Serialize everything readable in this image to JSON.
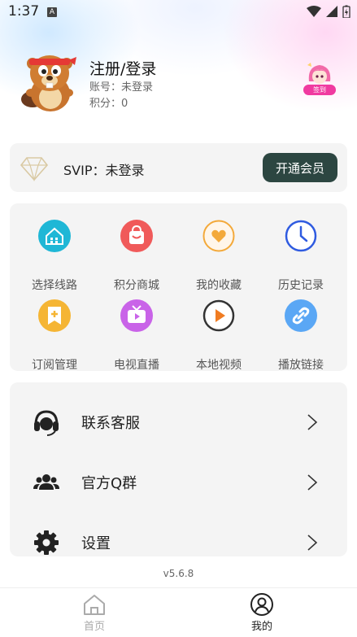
{
  "status_bar": {
    "time": "1:37",
    "notification_icon": "A"
  },
  "profile": {
    "name": "注册/登录",
    "account": "账号：未登录",
    "points": "积分：0",
    "avatar": "beaver-mascot-avatar",
    "sign_badge": "签到"
  },
  "svip": {
    "text": "SVIP：未登录",
    "button": "开通会员"
  },
  "grid": [
    {
      "label": "选择线路",
      "icon": "route-select-icon",
      "color": "#1fb7d6"
    },
    {
      "label": "积分商城",
      "icon": "shopping-bag-icon",
      "color": "#f05a5a"
    },
    {
      "label": "我的收藏",
      "icon": "heart-icon",
      "color": "#f3a93a"
    },
    {
      "label": "历史记录",
      "icon": "clock-icon",
      "color": "#2f5be0"
    },
    {
      "label": "订阅管理",
      "icon": "bookmark-plus-icon",
      "color": "#f5b534"
    },
    {
      "label": "电视直播",
      "icon": "tv-icon",
      "color": "#c963e8"
    },
    {
      "label": "本地视频",
      "icon": "play-circle-icon",
      "color": "#f07c22"
    },
    {
      "label": "播放链接",
      "icon": "link-icon",
      "color": "#5aa7f5"
    }
  ],
  "list": [
    {
      "label": "联系客服",
      "icon": "headset-icon"
    },
    {
      "label": "官方Q群",
      "icon": "group-icon"
    },
    {
      "label": "设置",
      "icon": "gear-icon"
    }
  ],
  "version": "v5.6.8",
  "nav": [
    {
      "label": "首页",
      "icon": "home-icon",
      "active": false
    },
    {
      "label": "我的",
      "icon": "user-icon",
      "active": true
    }
  ],
  "colors": {
    "vip_button": "#2c4641",
    "nav_active": "#222222",
    "nav_inactive": "#aaaaaa"
  }
}
